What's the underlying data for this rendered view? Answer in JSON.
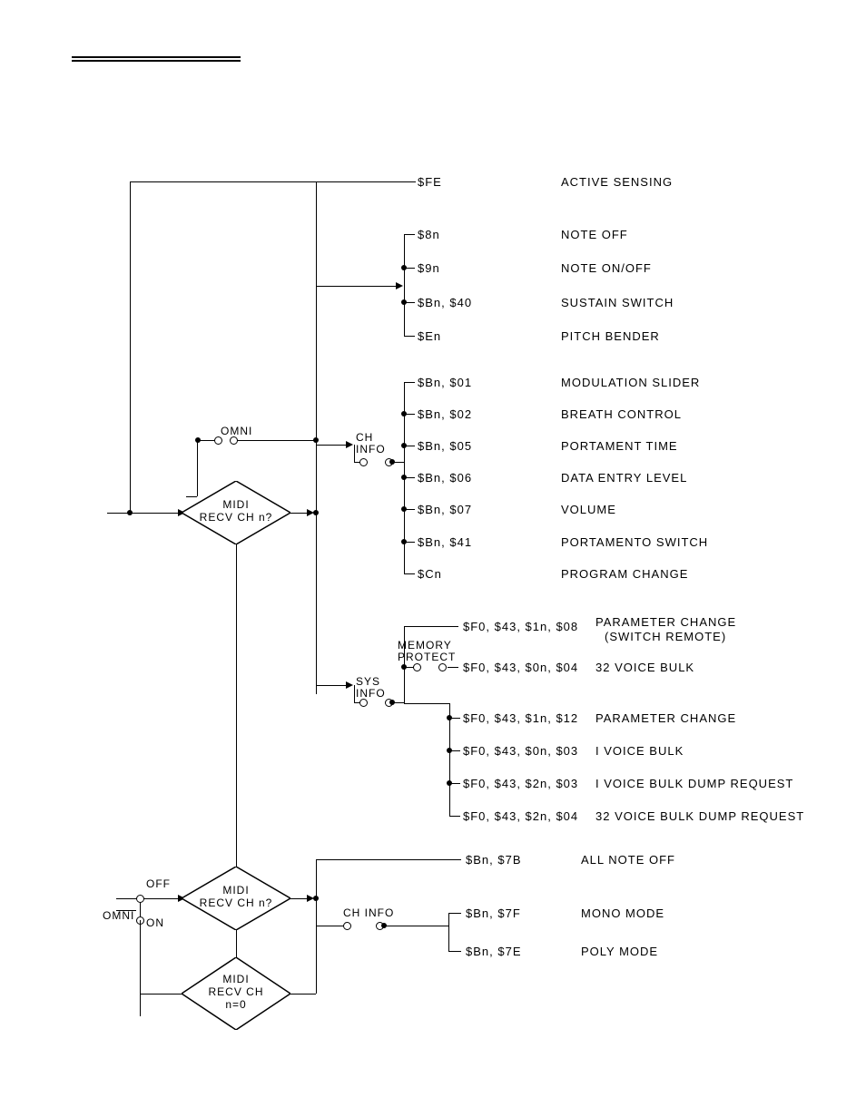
{
  "messages": {
    "fe": {
      "code": "$FE",
      "desc": "ACTIVE SENSING"
    },
    "8n": {
      "code": "$8n",
      "desc": "NOTE OFF"
    },
    "9n": {
      "code": "$9n",
      "desc": "NOTE ON/OFF"
    },
    "bn40": {
      "code": "$Bn, $40",
      "desc": "SUSTAIN SWITCH"
    },
    "en": {
      "code": "$En",
      "desc": "PITCH BENDER"
    },
    "bn01": {
      "code": "$Bn, $01",
      "desc": "MODULATION SLIDER"
    },
    "bn02": {
      "code": "$Bn, $02",
      "desc": "BREATH CONTROL"
    },
    "bn05": {
      "code": "$Bn, $05",
      "desc": "PORTAMENT TIME"
    },
    "bn06": {
      "code": "$Bn, $06",
      "desc": "DATA ENTRY LEVEL"
    },
    "bn07": {
      "code": "$Bn, $07",
      "desc": "VOLUME"
    },
    "bn41": {
      "code": "$Bn, $41",
      "desc": "PORTAMENTO SWITCH"
    },
    "cn": {
      "code": "$Cn",
      "desc": "PROGRAM CHANGE"
    },
    "f0_1n_08": {
      "code": "$F0, $43, $1n, $08",
      "desc": "PARAMETER CHANGE",
      "desc2": "(SWITCH REMOTE)"
    },
    "f0_0n_04": {
      "code": "$F0, $43, $0n, $04",
      "desc": "32 VOICE BULK"
    },
    "f0_1n_12": {
      "code": "$F0, $43, $1n, $12",
      "desc": "PARAMETER CHANGE"
    },
    "f0_0n_03": {
      "code": "$F0, $43, $0n, $03",
      "desc": "I VOICE BULK"
    },
    "f0_2n_03": {
      "code": "$F0, $43, $2n, $03",
      "desc": "I VOICE BULK DUMP REQUEST"
    },
    "f0_2n_04": {
      "code": "$F0, $43, $2n, $04",
      "desc": "32 VOICE BULK DUMP REQUEST"
    },
    "bn7b": {
      "code": "$Bn, $7B",
      "desc": "ALL NOTE OFF"
    },
    "bn7f": {
      "code": "$Bn, $7F",
      "desc": "MONO MODE"
    },
    "bn7e": {
      "code": "$Bn, $7E",
      "desc": "POLY MODE"
    }
  },
  "switches": {
    "omni": "OMNI",
    "ch_info": "CH\nINFO",
    "sys_info": "SYS\nINFO",
    "memory_protect": "MEMORY\nPROTECT",
    "ch_info2": "CH INFO",
    "off": "OFF",
    "on": "ON",
    "omni2": "OMNI"
  },
  "diamonds": {
    "midi_recv1": "MIDI\nRECV CH n?",
    "midi_recv2": "MIDI\nRECV CH n?",
    "midi_recv_n0": "MIDI\nRECV CH\nn=0"
  }
}
